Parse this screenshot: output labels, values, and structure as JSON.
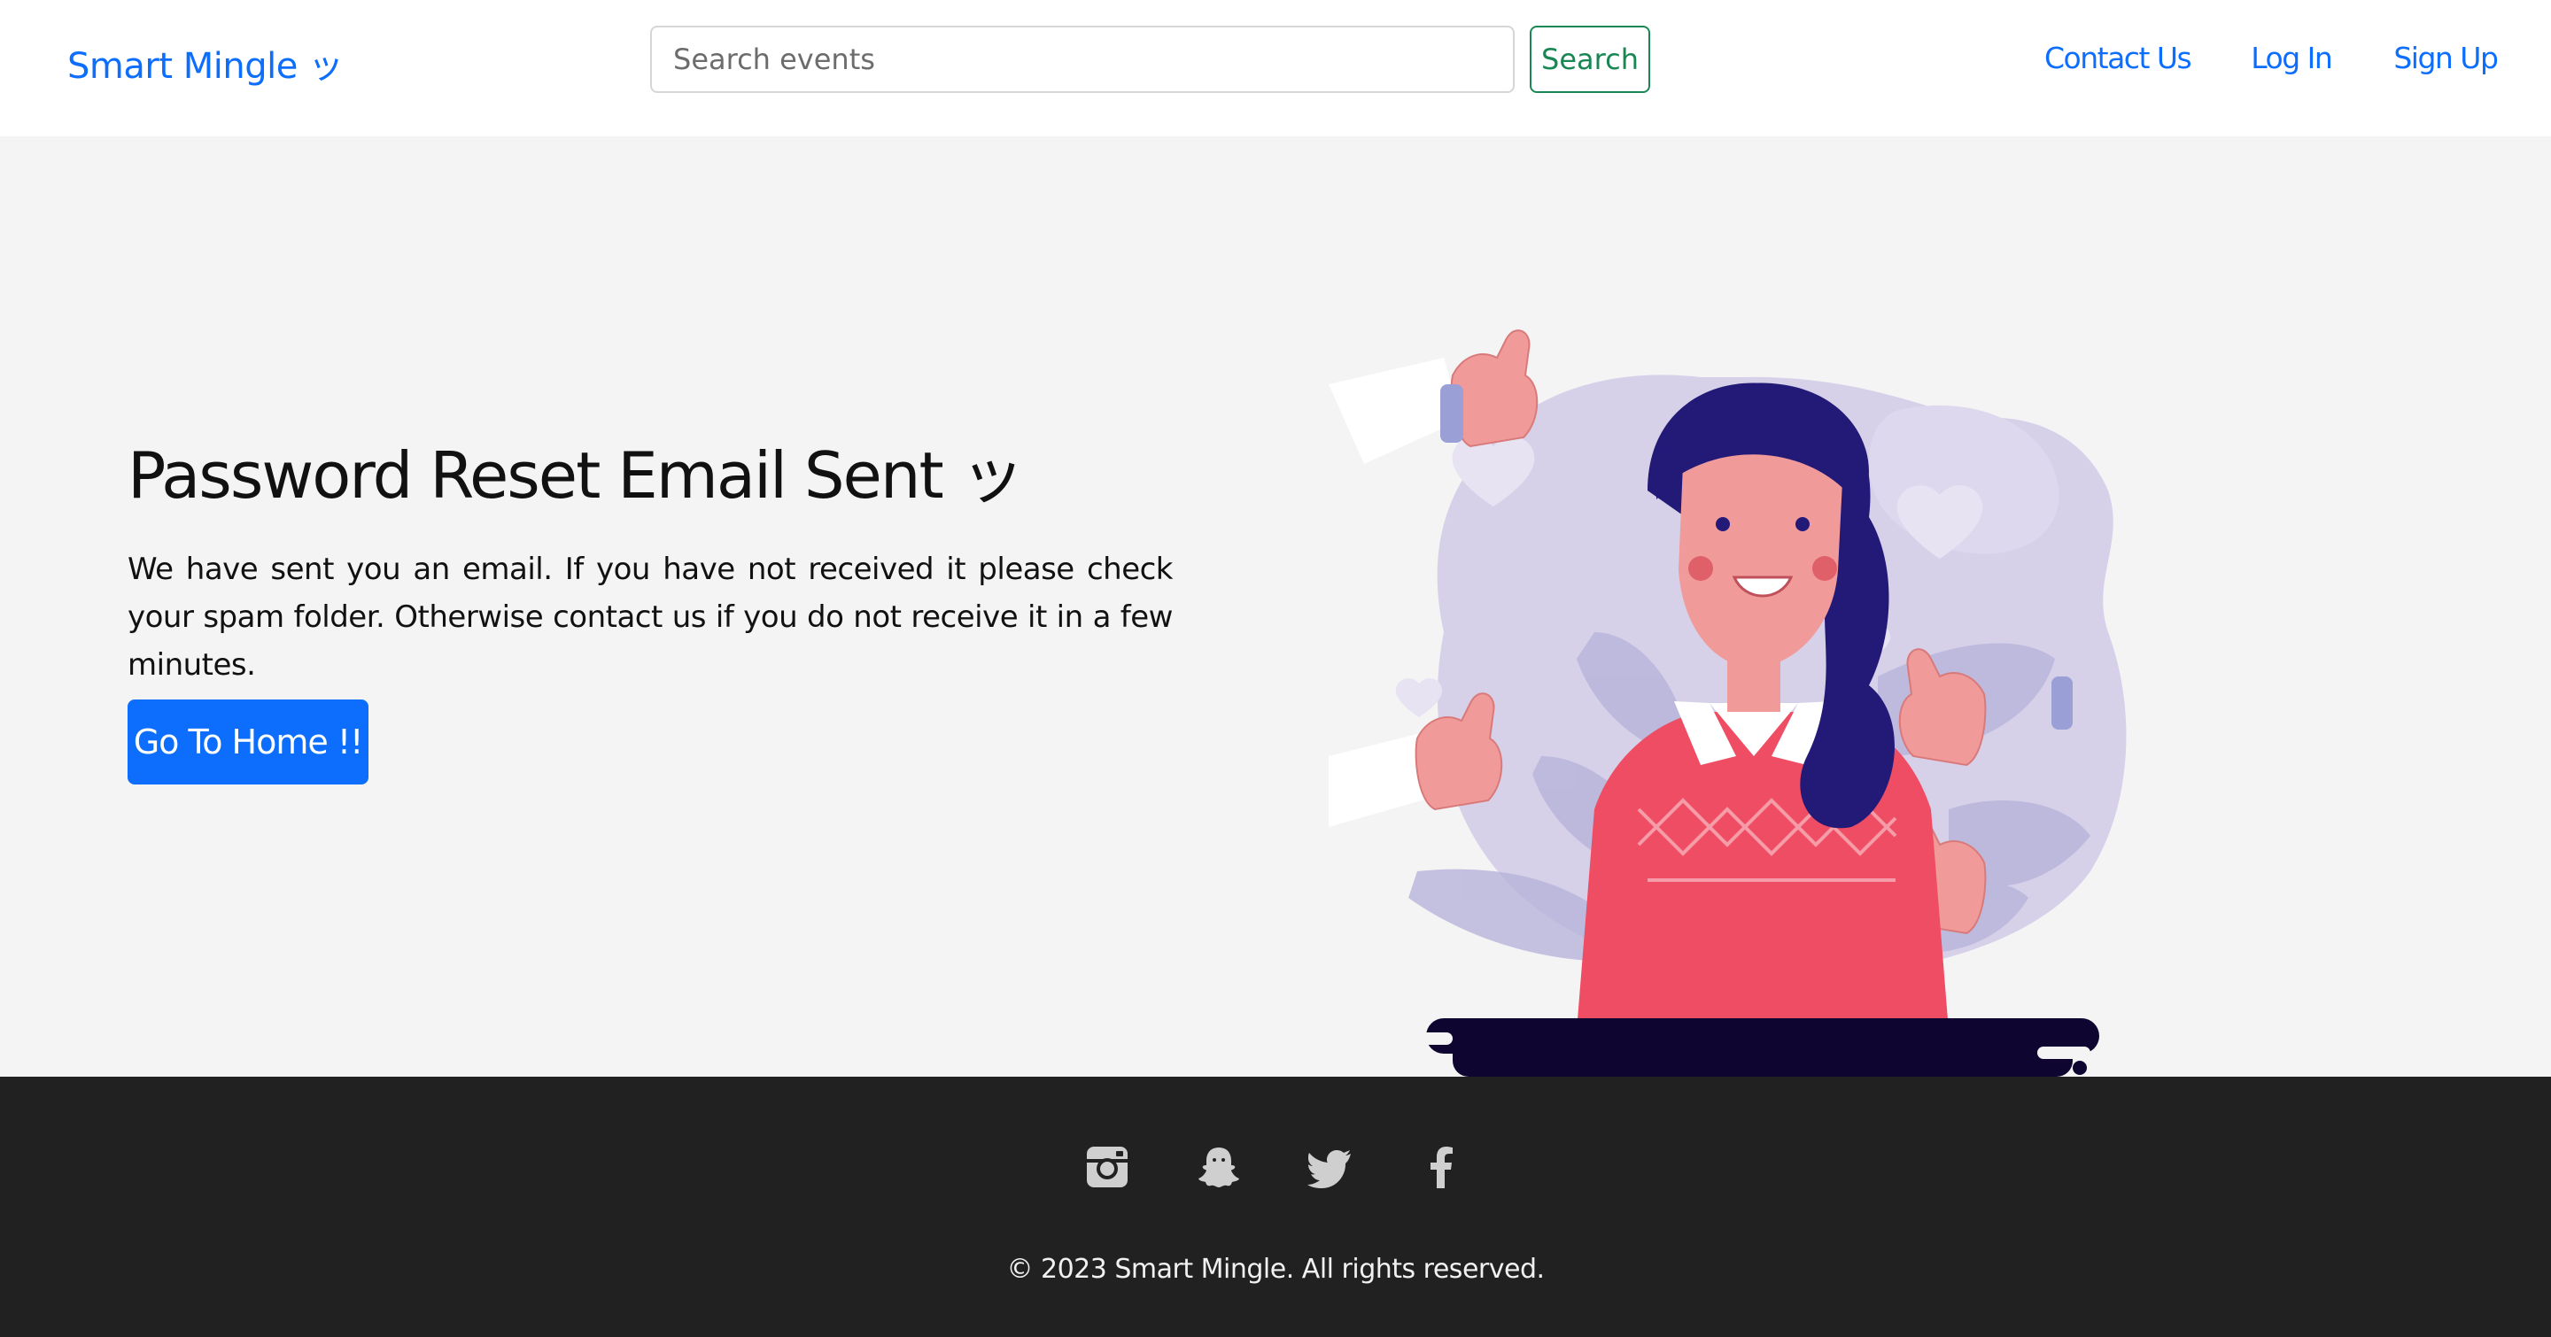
{
  "header": {
    "brand": "Smart Mingle ッ",
    "search": {
      "placeholder": "Search events",
      "value": "",
      "button_label": "Search"
    },
    "nav": {
      "contact": "Contact Us",
      "login": "Log In",
      "signup": "Sign Up"
    }
  },
  "main": {
    "title": "Password Reset Email Sent ッ",
    "message": "We have sent you an email. If you have not received it please check your spam folder. Otherwise contact us if you do not receive it in a few minutes.",
    "home_button": "Go To Home !!",
    "illustration_icon": "woman-thumbs-up-illustration"
  },
  "footer": {
    "socials": [
      {
        "icon": "instagram-icon"
      },
      {
        "icon": "snapchat-icon"
      },
      {
        "icon": "twitter-icon"
      },
      {
        "icon": "facebook-icon"
      }
    ],
    "copyright": "© 2023 Smart Mingle. All rights reserved."
  },
  "colors": {
    "primary": "#0d6efd",
    "success": "#198754",
    "footer_bg": "#212121",
    "page_bg": "#f4f4f4",
    "icon": "#cfcfcf"
  }
}
